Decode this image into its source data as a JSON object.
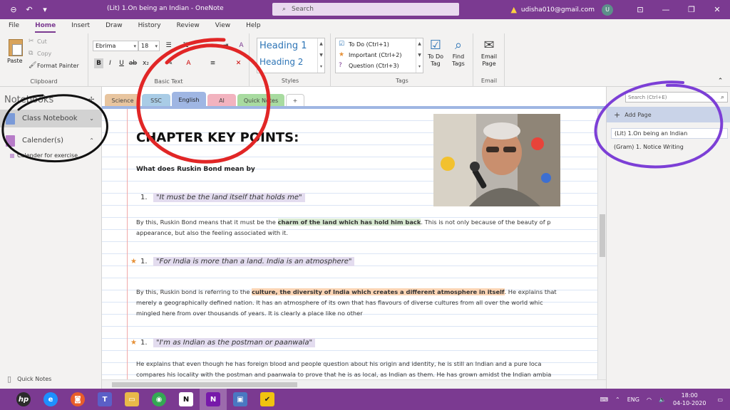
{
  "colors": {
    "accent": "#7b3a91",
    "section_active": "#9fb6e3",
    "ann_red": "#e12626",
    "ann_purple": "#7c3fd6"
  },
  "titlebar": {
    "title": "(Lit) 1.On being an Indian  -  OneNote",
    "search_placeholder": "Search",
    "user_email": "udisha010@gmail.com",
    "avatar_initial": "U"
  },
  "menu": {
    "items": [
      "File",
      "Home",
      "Insert",
      "Draw",
      "History",
      "Review",
      "View",
      "Help"
    ],
    "active": "Home"
  },
  "ribbon": {
    "clipboard": {
      "paste": "Paste",
      "cut": "Cut",
      "copy": "Copy",
      "format_painter": "Format Painter",
      "label": "Clipboard"
    },
    "basic_text": {
      "font": "Ebrima",
      "size": "18",
      "label": "Basic Text"
    },
    "styles": {
      "heading1": "Heading 1",
      "heading2": "Heading 2",
      "label": "Styles"
    },
    "tags": {
      "todo": "To Do (Ctrl+1)",
      "important": "Important (Ctrl+2)",
      "question": "Question (Ctrl+3)",
      "todo_tag": "To Do Tag",
      "find_tags": "Find Tags",
      "label": "Tags"
    },
    "email": {
      "email_page": "Email Page",
      "label": "Email"
    }
  },
  "left_panel": {
    "title": "Notebooks",
    "notebooks": [
      {
        "name": "Class Notebook",
        "color": "#7a9ad8"
      },
      {
        "name": "Calender(s)",
        "color": "#b77cc8"
      }
    ],
    "section": "Calender for exercise",
    "quick_notes": "Quick Notes"
  },
  "section_tabs": [
    {
      "label": "Science",
      "color": "#e8c59f"
    },
    {
      "label": "SSC",
      "color": "#a9cce6"
    },
    {
      "label": "English",
      "color": "#9fb6e3",
      "active": true
    },
    {
      "label": "AI",
      "color": "#f2b3bf"
    },
    {
      "label": "Quick Notes",
      "color": "#a8dba0"
    },
    {
      "label": "+",
      "color": "#ffffff"
    }
  ],
  "page": {
    "title": "CHAPTER KEY POINTS:",
    "question": "What does Ruskin Bond mean by",
    "quotes": [
      {
        "num": "1.",
        "text": "\"It must be the land itself that holds me\""
      },
      {
        "num": "1.",
        "text": "\"For India is more than a land. India is an atmosphere\""
      },
      {
        "num": "1.",
        "text": "\"I'm as Indian as the postman or paanwala\""
      }
    ],
    "para1": {
      "a": "By this, Ruskin Bond means that it must be the ",
      "hl": "charm of the land which has hold him back",
      "b": ". This is not only because of the beauty of p",
      "line2": "appearance, but also the feeling associated with it."
    },
    "para2": {
      "a": "By this, Ruskin bond is referring to the ",
      "hl": "culture, the diversity of India which creates a different atmosphere in itself",
      "b": ". He explains that",
      "line2": "merely a geographically defined nation. It has an atmosphere of its own that has flavours of diverse cultures from all over the world whic",
      "line3": "mingled here from over thousands of years. It is clearly a place like no other"
    },
    "para3": {
      "line1": "He explains that even though he has foreign blood and people question about his origin and identity, he is still an Indian and a pure loca",
      "line2": "compares his locality with the postman and paanwala to prove that he is as local, as Indian as them. He has grown amidst the Indian ambia"
    }
  },
  "right_panel": {
    "search_placeholder": "Search (Ctrl+E)",
    "add_page": "Add Page",
    "pages": [
      {
        "title": "(Lit) 1.On being an Indian",
        "selected": true
      },
      {
        "title": "(Gram) 1. Notice Writing",
        "selected": false
      }
    ]
  },
  "taskbar": {
    "apps": [
      {
        "name": "HP",
        "color": "#2b2b2b",
        "glyph": "hp"
      },
      {
        "name": "Internet Explorer",
        "color": "#1e90ff",
        "glyph": "e"
      },
      {
        "name": "Zoom",
        "color": "#e85d2a",
        "glyph": "◙"
      },
      {
        "name": "Teams",
        "color": "#5b5fc7",
        "glyph": "T"
      },
      {
        "name": "File Explorer",
        "color": "#e9b949",
        "glyph": "▭"
      },
      {
        "name": "Chrome",
        "color": "#34a853",
        "glyph": "◉"
      },
      {
        "name": "Notion",
        "color": "#ffffff",
        "glyph": "N"
      },
      {
        "name": "OneNote",
        "color": "#7719aa",
        "glyph": "N",
        "active": true
      },
      {
        "name": "Photos",
        "color": "#4a78c2",
        "glyph": "▣"
      },
      {
        "name": "Tasks",
        "color": "#f0c30f",
        "glyph": "✔"
      }
    ],
    "lang": "ENG",
    "time": "18:00",
    "date": "04-10-2020"
  }
}
